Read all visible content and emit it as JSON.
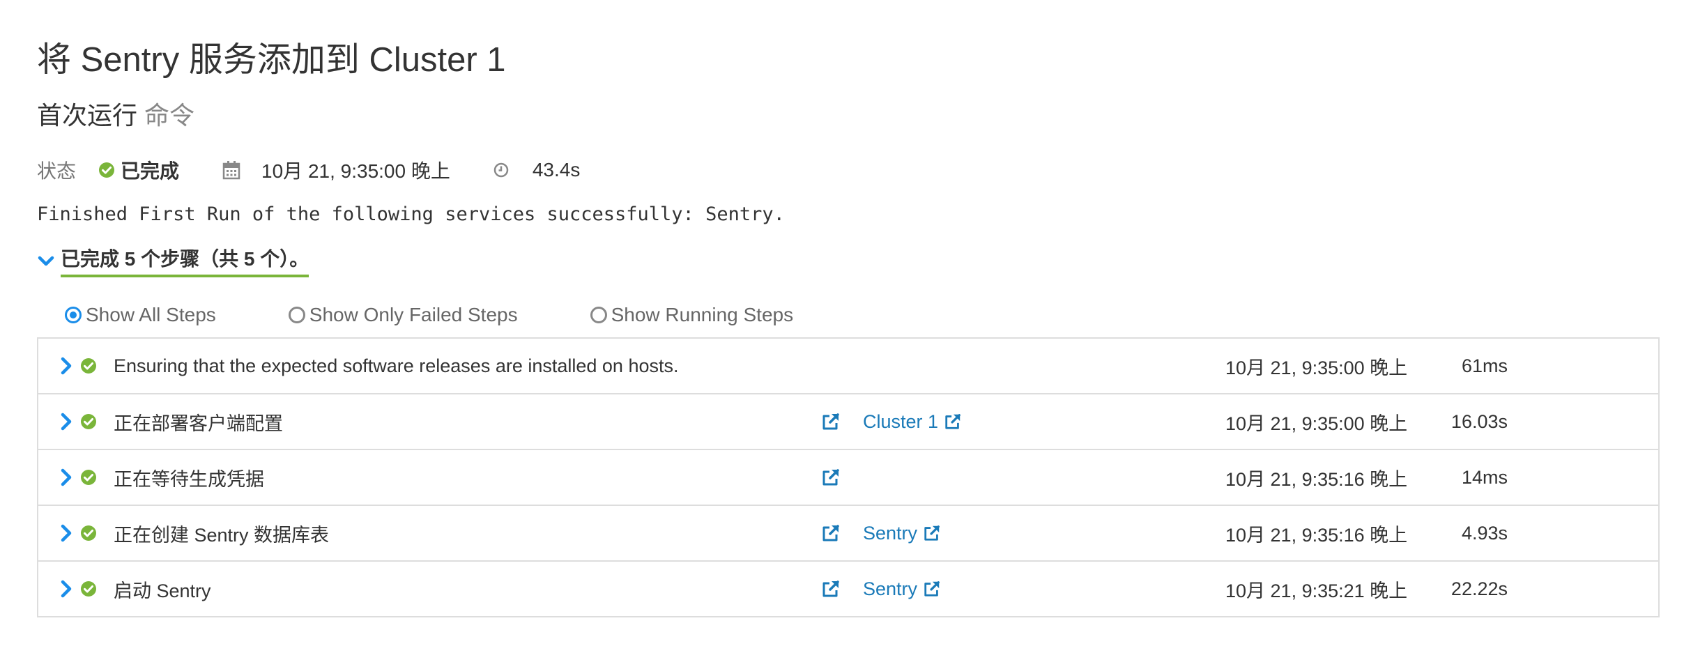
{
  "page": {
    "title": "将 Sentry 服务添加到 Cluster 1",
    "subtitle_main": "首次运行",
    "subtitle_muted": "命令"
  },
  "status": {
    "label": "状态",
    "value": "已完成",
    "timestamp": "10月 21, 9:35:00 晚上",
    "duration": "43.4s"
  },
  "message": "Finished First Run of the following services successfully: Sentry.",
  "steps_summary": "已完成 5 个步骤（共 5 个）。",
  "filters": [
    {
      "label": "Show All Steps",
      "selected": true
    },
    {
      "label": "Show Only Failed Steps",
      "selected": false
    },
    {
      "label": "Show Running Steps",
      "selected": false
    }
  ],
  "steps": [
    {
      "name": "Ensuring that the expected software releases are installed on hosts.",
      "has_ext": false,
      "link": "",
      "time": "10月 21, 9:35:00 晚上",
      "duration": "61ms"
    },
    {
      "name": "正在部署客户端配置",
      "has_ext": true,
      "link": "Cluster 1",
      "time": "10月 21, 9:35:00 晚上",
      "duration": "16.03s"
    },
    {
      "name": "正在等待生成凭据",
      "has_ext": true,
      "link": "",
      "time": "10月 21, 9:35:16 晚上",
      "duration": "14ms"
    },
    {
      "name": "正在创建 Sentry 数据库表",
      "has_ext": true,
      "link": "Sentry",
      "time": "10月 21, 9:35:16 晚上",
      "duration": "4.93s"
    },
    {
      "name": "启动 Sentry",
      "has_ext": true,
      "link": "Sentry",
      "time": "10月 21, 9:35:21 晚上",
      "duration": "22.22s"
    }
  ],
  "colors": {
    "success_green": "#7ab53a",
    "link_blue": "#1a7ab8",
    "radio_blue": "#1a8de9",
    "chevron_blue": "#1a8de9"
  },
  "icons": {
    "status": "check-circle-icon",
    "date": "calendar-icon",
    "duration": "clock-icon",
    "toggle": "chevron-down-icon",
    "row_expand": "chevron-right-icon",
    "external": "external-link-icon"
  }
}
